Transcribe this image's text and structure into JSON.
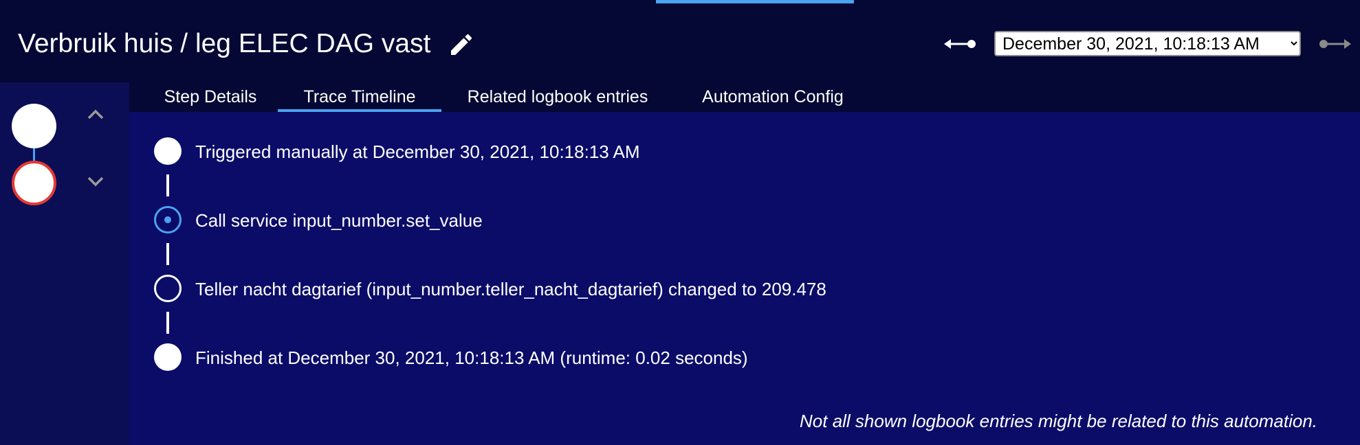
{
  "header": {
    "title": "Verbruik huis / leg ELEC DAG vast",
    "edit_icon": "pencil-icon",
    "older_icon": "arrow-left-icon",
    "newer_icon": "arrow-right-icon",
    "selected_run": "December 30, 2021, 10:18:13 AM",
    "run_options": [
      "December 30, 2021, 10:18:13 AM"
    ]
  },
  "sidebar": {
    "nodes": [
      {
        "type": "trigger",
        "status": "ok"
      },
      {
        "type": "action",
        "status": "selected"
      }
    ],
    "up_icon": "chevron-up-icon",
    "down_icon": "chevron-down-icon"
  },
  "tabs": [
    {
      "label": "Step Details",
      "active": false
    },
    {
      "label": "Trace Timeline",
      "active": true
    },
    {
      "label": "Related logbook entries",
      "active": false
    },
    {
      "label": "Automation Config",
      "active": false
    }
  ],
  "timeline": {
    "entries": [
      {
        "text": "Triggered manually at December 30, 2021, 10:18:13 AM",
        "icon": "filled-circle-icon"
      },
      {
        "text": "Call service input_number.set_value",
        "icon": "radio-active-icon"
      },
      {
        "text": "Teller nacht dagtarief (input_number.teller_nacht_dagtarief) changed to 209.478",
        "icon": "ring-circle-icon"
      },
      {
        "text": "Finished at December 30, 2021, 10:18:13 AM (runtime: 0.02 seconds)",
        "icon": "filled-circle-icon"
      }
    ],
    "note": "Not all shown logbook entries might be related to this automation."
  },
  "colors": {
    "header_bg": "#050834",
    "content_bg": "#0b0c68",
    "sidebar_bg": "#0b0d55",
    "accent": "#4aa3f0",
    "error": "#e53935"
  }
}
